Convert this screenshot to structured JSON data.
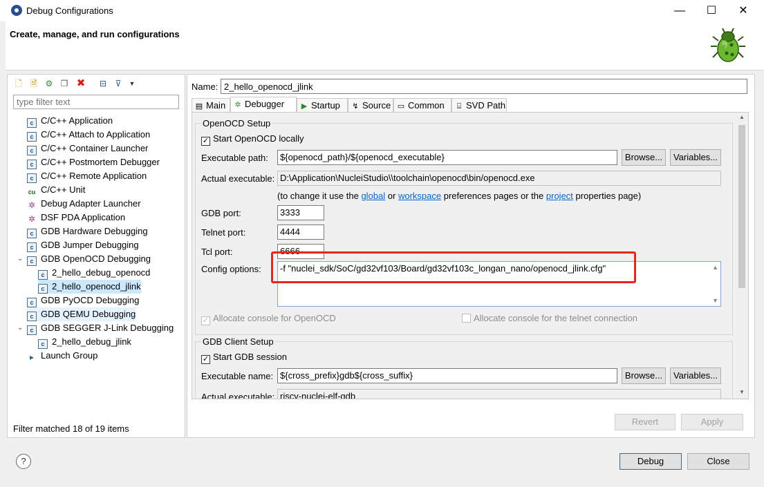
{
  "window": {
    "title": "Debug Configurations",
    "minimize": "—",
    "maximize": "☐",
    "close": "✕"
  },
  "header": {
    "title": "Create, manage, and run configurations"
  },
  "left": {
    "filter_placeholder": "type filter text",
    "tree": [
      {
        "label": "C/C++ Application",
        "icon": "C"
      },
      {
        "label": "C/C++ Attach to Application",
        "icon": "C"
      },
      {
        "label": "C/C++ Container Launcher",
        "icon": "C"
      },
      {
        "label": "C/C++ Postmortem Debugger",
        "icon": "C"
      },
      {
        "label": "C/C++ Remote Application",
        "icon": "C"
      },
      {
        "label": "C/C++ Unit",
        "icon": "Cu"
      },
      {
        "label": "Debug Adapter Launcher",
        "icon": "bug"
      },
      {
        "label": "DSF PDA Application",
        "icon": "bug"
      },
      {
        "label": "GDB Hardware Debugging",
        "icon": "C"
      },
      {
        "label": "GDB Jumper Debugging",
        "icon": "C"
      },
      {
        "label": "GDB OpenOCD Debugging",
        "icon": "C"
      },
      {
        "label": "2_hello_debug_openocd",
        "icon": "C"
      },
      {
        "label": "2_hello_openocd_jlink",
        "icon": "C"
      },
      {
        "label": "GDB PyOCD Debugging",
        "icon": "C"
      },
      {
        "label": "GDB QEMU Debugging",
        "icon": "C"
      },
      {
        "label": "GDB SEGGER J-Link Debugging",
        "icon": "C"
      },
      {
        "label": "2_hello_debug_jlink",
        "icon": "C"
      },
      {
        "label": "Launch Group",
        "icon": "launch"
      }
    ],
    "status": "Filter matched 18 of 19 items"
  },
  "right": {
    "name_label": "Name:",
    "name_value": "2_hello_openocd_jlink",
    "tabs": [
      "Main",
      "Debugger",
      "Startup",
      "Source",
      "Common",
      "SVD Path"
    ],
    "openocd": {
      "group_label": "OpenOCD Setup",
      "start_locally": "Start OpenOCD locally",
      "exec_label": "Executable path:",
      "exec_value": "${openocd_path}/${openocd_executable}",
      "actual_label": "Actual executable:",
      "actual_value": "D:\\Application\\NucleiStudio\\\\toolchain\\openocd\\bin/openocd.exe",
      "note_prefix": "(to change it use the",
      "note_global": "global",
      "note_or": "or",
      "note_workspace": "workspace",
      "note_mid": "preferences pages or the",
      "note_project": "project",
      "note_suffix": "properties page)",
      "gdb_port_label": "GDB port:",
      "gdb_port": "3333",
      "telnet_port_label": "Telnet port:",
      "telnet_port": "4444",
      "tcl_port_label": "Tcl port:",
      "tcl_port": "6666",
      "config_label": "Config options:",
      "config_value": "-f \"nuclei_sdk/SoC/gd32vf103/Board/gd32vf103c_longan_nano/openocd_jlink.cfg\"",
      "alloc_console": "Allocate console for OpenOCD",
      "alloc_telnet": "Allocate console for the telnet connection"
    },
    "gdb": {
      "group_label": "GDB Client Setup",
      "start_session": "Start GDB session",
      "exec_label": "Executable name:",
      "exec_value": "${cross_prefix}gdb${cross_suffix}",
      "actual_label": "Actual executable:",
      "actual_value": "riscv-nuclei-elf-gdb"
    },
    "browse": "Browse...",
    "variables": "Variables...",
    "revert": "Revert",
    "apply": "Apply"
  },
  "footer": {
    "help": "?",
    "debug": "Debug",
    "close": "Close"
  }
}
